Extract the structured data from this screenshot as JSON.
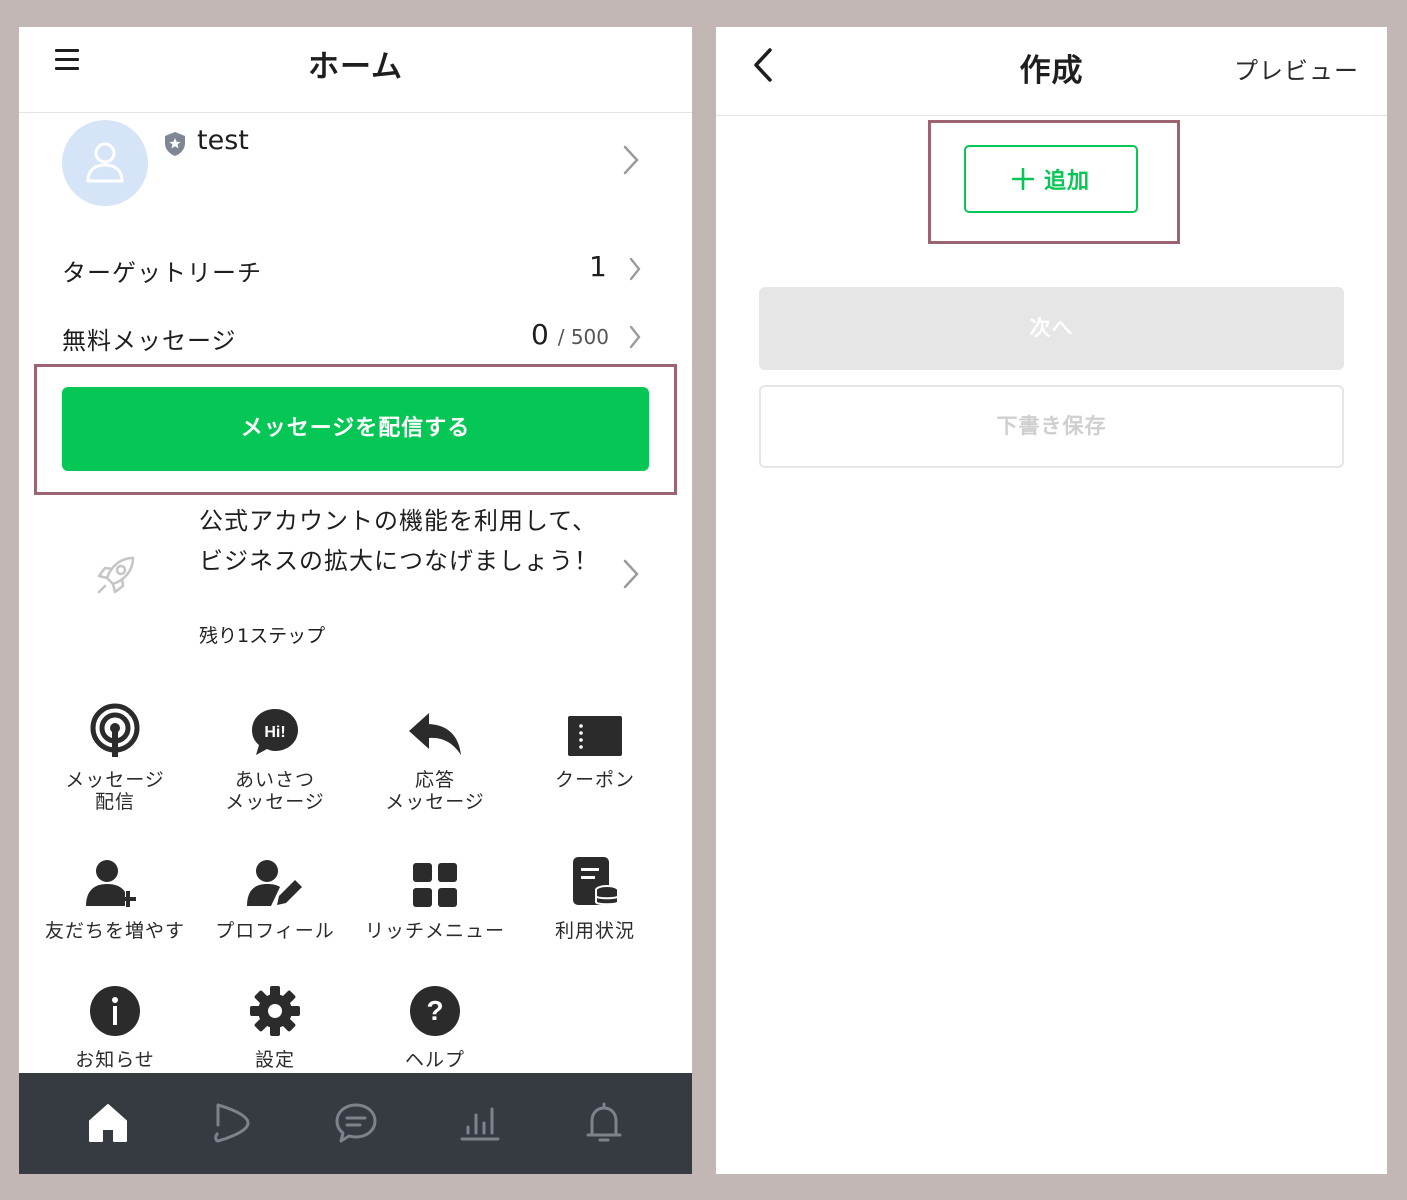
{
  "home": {
    "header": {
      "title": "ホーム"
    },
    "profile": {
      "name": "test"
    },
    "stats": {
      "target_reach": {
        "label": "ターゲットリーチ",
        "value": "1"
      },
      "free_messages": {
        "label": "無料メッセージ",
        "value": "0",
        "limit": "/ 500"
      }
    },
    "cta_label": "メッセージを配信する",
    "promo": {
      "text": "公式アカウントの機能を利用して、ビジネスの拡大につなげましょう！",
      "steps": "残り1ステップ"
    },
    "menu_tiles": [
      {
        "label": "メッセージ\n配信",
        "icon": "broadcast-icon"
      },
      {
        "label": "あいさつ\nメッセージ",
        "icon": "greeting-icon"
      },
      {
        "label": "応答\nメッセージ",
        "icon": "reply-icon"
      },
      {
        "label": "クーポン",
        "icon": "coupon-icon"
      },
      {
        "label": "友だちを増やす",
        "icon": "add-friend-icon"
      },
      {
        "label": "プロフィール",
        "icon": "profile-edit-icon"
      },
      {
        "label": "リッチメニュー",
        "icon": "rich-menu-icon"
      },
      {
        "label": "利用状況",
        "icon": "usage-icon"
      },
      {
        "label": "お知らせ",
        "icon": "info-icon"
      },
      {
        "label": "設定",
        "icon": "gear-icon"
      },
      {
        "label": "ヘルプ",
        "icon": "help-icon"
      }
    ],
    "bottom_nav": [
      "home-icon",
      "voom-icon",
      "chat-icon",
      "analytics-icon",
      "bell-icon"
    ]
  },
  "create": {
    "header": {
      "title": "作成",
      "preview": "プレビュー"
    },
    "add_label": "追加",
    "next_label": "次へ",
    "draft_label": "下書き保存"
  },
  "colors": {
    "brand_green": "#06c755",
    "highlight": "#9b6470",
    "nav_bg": "#363a41",
    "disabled": "#e6e6e6"
  }
}
